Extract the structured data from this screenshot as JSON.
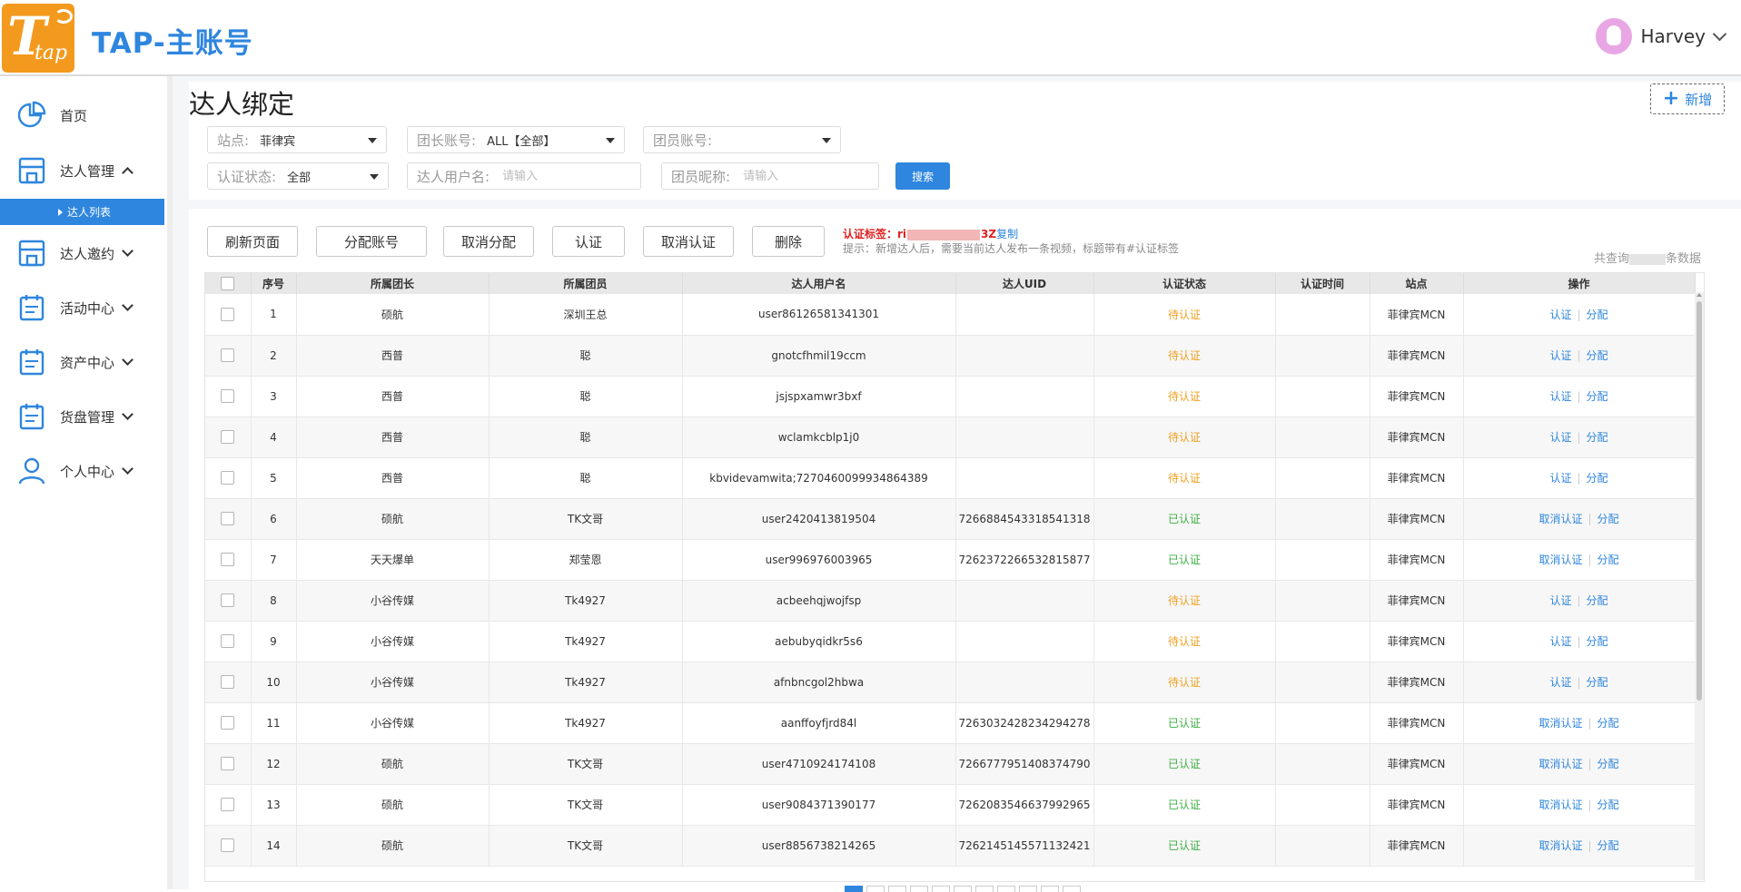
{
  "header": {
    "app_title": "TAP-主账号",
    "logo_letter": "T",
    "logo_subtext": "tap",
    "user_name": "Harvey"
  },
  "sidebar": {
    "items": [
      {
        "label": "首页",
        "icon": "pie-chart-icon"
      },
      {
        "label": "达人管理",
        "icon": "store-icon",
        "expanded": true
      },
      {
        "label": "达人邀约",
        "icon": "store-icon"
      },
      {
        "label": "活动中心",
        "icon": "calendar-icon"
      },
      {
        "label": "资产中心",
        "icon": "calendar-icon"
      },
      {
        "label": "货盘管理",
        "icon": "calendar-icon"
      },
      {
        "label": "个人中心",
        "icon": "user-icon"
      }
    ],
    "active_sub_item": "达人列表"
  },
  "page": {
    "title": "达人绑定",
    "new_button": "新增"
  },
  "filters": {
    "site": {
      "label": "站点:",
      "value": "菲律宾"
    },
    "leader_account": {
      "label": "团长账号:",
      "value": "ALL【全部】"
    },
    "member_account": {
      "label": "团员账号:",
      "value": ""
    },
    "auth_status": {
      "label": "认证状态:",
      "value": "全部"
    },
    "talent_username": {
      "label": "达人用户名:",
      "placeholder": "请输入"
    },
    "member_nickname": {
      "label": "团员昵称:",
      "placeholder": "请输入"
    },
    "search_button": "搜索"
  },
  "toolbar": {
    "buttons": [
      "刷新页面",
      "分配账号",
      "取消分配",
      "认证",
      "取消认证",
      "删除"
    ],
    "tag_label": "认证标签：ri",
    "tag_suffix": "3Z",
    "copy_label": "复制",
    "tip": "提示：新增达人后，需要当前达人发布一条视频，标题带有#认证标签",
    "total_prefix": "共查询",
    "total_suffix": "条数据"
  },
  "table": {
    "columns": [
      "",
      "序号",
      "所属团长",
      "所属团员",
      "达人用户名",
      "达人UID",
      "认证状态",
      "认证时间",
      "站点",
      "操作"
    ],
    "rows": [
      {
        "no": "1",
        "leader": "硕航",
        "member": "深圳王总",
        "username": "user86126581341301",
        "uid": "",
        "status": "待认证",
        "time": "",
        "site": "菲律宾MCN",
        "op1": "认证",
        "op2": "分配"
      },
      {
        "no": "2",
        "leader": "西普",
        "member": "聪",
        "username": "gnotcfhmil19ccm",
        "uid": "",
        "status": "待认证",
        "time": "",
        "site": "菲律宾MCN",
        "op1": "认证",
        "op2": "分配"
      },
      {
        "no": "3",
        "leader": "西普",
        "member": "聪",
        "username": "jsjspxamwr3bxf",
        "uid": "",
        "status": "待认证",
        "time": "",
        "site": "菲律宾MCN",
        "op1": "认证",
        "op2": "分配"
      },
      {
        "no": "4",
        "leader": "西普",
        "member": "聪",
        "username": "wclamkcblp1j0",
        "uid": "",
        "status": "待认证",
        "time": "",
        "site": "菲律宾MCN",
        "op1": "认证",
        "op2": "分配"
      },
      {
        "no": "5",
        "leader": "西普",
        "member": "聪",
        "username": "kbvidevamwita;7270460099934864389",
        "uid": "",
        "status": "待认证",
        "time": "",
        "site": "菲律宾MCN",
        "op1": "认证",
        "op2": "分配"
      },
      {
        "no": "6",
        "leader": "硕航",
        "member": "TK文哥",
        "username": "user2420413819504",
        "uid": "7266884543318541318",
        "status": "已认证",
        "time": "",
        "site": "菲律宾MCN",
        "op1": "取消认证",
        "op2": "分配"
      },
      {
        "no": "7",
        "leader": "天天爆单",
        "member": "郑莹恩",
        "username": "user996976003965",
        "uid": "7262372266532815877",
        "status": "已认证",
        "time": "",
        "site": "菲律宾MCN",
        "op1": "取消认证",
        "op2": "分配"
      },
      {
        "no": "8",
        "leader": "小谷传媒",
        "member": "Tk4927",
        "username": "acbeehqjwojfsp",
        "uid": "",
        "status": "待认证",
        "time": "",
        "site": "菲律宾MCN",
        "op1": "认证",
        "op2": "分配"
      },
      {
        "no": "9",
        "leader": "小谷传媒",
        "member": "Tk4927",
        "username": "aebubyqidkr5s6",
        "uid": "",
        "status": "待认证",
        "time": "",
        "site": "菲律宾MCN",
        "op1": "认证",
        "op2": "分配"
      },
      {
        "no": "10",
        "leader": "小谷传媒",
        "member": "Tk4927",
        "username": "afnbncgol2hbwa",
        "uid": "",
        "status": "待认证",
        "time": "",
        "site": "菲律宾MCN",
        "op1": "认证",
        "op2": "分配"
      },
      {
        "no": "11",
        "leader": "小谷传媒",
        "member": "Tk4927",
        "username": "aanffoyfjrd84l",
        "uid": "7263032428234294278",
        "status": "已认证",
        "time": "",
        "site": "菲律宾MCN",
        "op1": "取消认证",
        "op2": "分配"
      },
      {
        "no": "12",
        "leader": "硕航",
        "member": "TK文哥",
        "username": "user4710924174108",
        "uid": "7266777951408374790",
        "status": "已认证",
        "time": "",
        "site": "菲律宾MCN",
        "op1": "取消认证",
        "op2": "分配"
      },
      {
        "no": "13",
        "leader": "硕航",
        "member": "TK文哥",
        "username": "user9084371390177",
        "uid": "7262083546637992965",
        "status": "已认证",
        "time": "",
        "site": "菲律宾MCN",
        "op1": "取消认证",
        "op2": "分配"
      },
      {
        "no": "14",
        "leader": "硕航",
        "member": "TK文哥",
        "username": "user8856738214265",
        "uid": "7262145145571132421",
        "status": "已认证",
        "time": "",
        "site": "菲律宾MCN",
        "op1": "取消认证",
        "op2": "分配"
      }
    ]
  },
  "colors": {
    "accent": "#2e86de",
    "pending": "#f0a020",
    "verified": "#3cb043",
    "tag_red": "#e02020",
    "logo_orange": "#f39a1e"
  }
}
